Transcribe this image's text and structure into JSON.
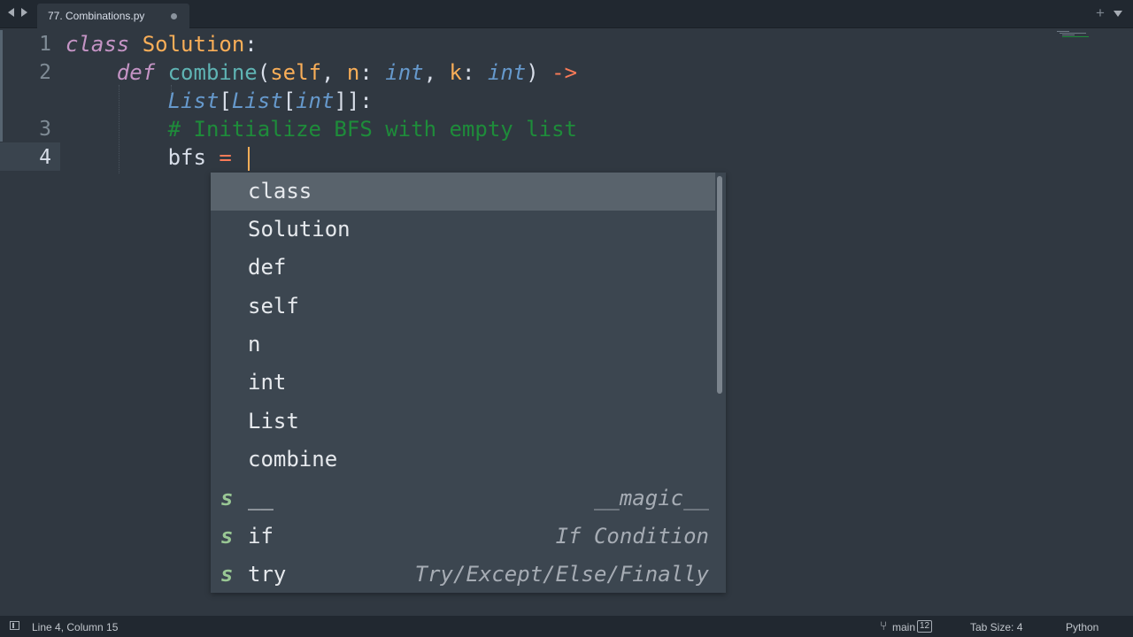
{
  "tab": {
    "filename": "77. Combinations.py",
    "add": "+"
  },
  "editor": {
    "line_numbers": [
      "1",
      "2",
      "3",
      "4"
    ],
    "line1": {
      "kw": "class",
      "name": "Solution",
      "colon": ":"
    },
    "line2a": {
      "kw": "def",
      "fn": "combine",
      "open": "(",
      "self": "self",
      "comma1": ", ",
      "n": "n",
      "colon1": ": ",
      "int1": "int",
      "comma2": ", ",
      "k": "k",
      "colon2": ": ",
      "int2": "int",
      "close": ")",
      "arrow": "->"
    },
    "line2b": {
      "list1": "List",
      "b1": "[",
      "list2": "List",
      "b2": "[",
      "int": "int",
      "b3": "]]",
      "colon": ":"
    },
    "line3": {
      "comment": "# Initialize BFS with empty list"
    },
    "line4": {
      "var": "bfs",
      "eq": "="
    }
  },
  "autocomplete": {
    "items": [
      {
        "label": "class",
        "kind": "",
        "hint": ""
      },
      {
        "label": "Solution",
        "kind": "",
        "hint": ""
      },
      {
        "label": "def",
        "kind": "",
        "hint": ""
      },
      {
        "label": "self",
        "kind": "",
        "hint": ""
      },
      {
        "label": "n",
        "kind": "",
        "hint": ""
      },
      {
        "label": "int",
        "kind": "",
        "hint": ""
      },
      {
        "label": "List",
        "kind": "",
        "hint": ""
      },
      {
        "label": "combine",
        "kind": "",
        "hint": ""
      },
      {
        "label": "__",
        "kind": "s",
        "hint": "__magic__"
      },
      {
        "label": "if",
        "kind": "s",
        "hint": "If Condition"
      },
      {
        "label": "try",
        "kind": "s",
        "hint": "Try/Except/Else/Finally"
      }
    ],
    "selected_index": 0
  },
  "status": {
    "position": "Line 4, Column 15",
    "branch": "main",
    "branch_count": "12",
    "tab_size": "Tab Size: 4",
    "syntax": "Python"
  }
}
